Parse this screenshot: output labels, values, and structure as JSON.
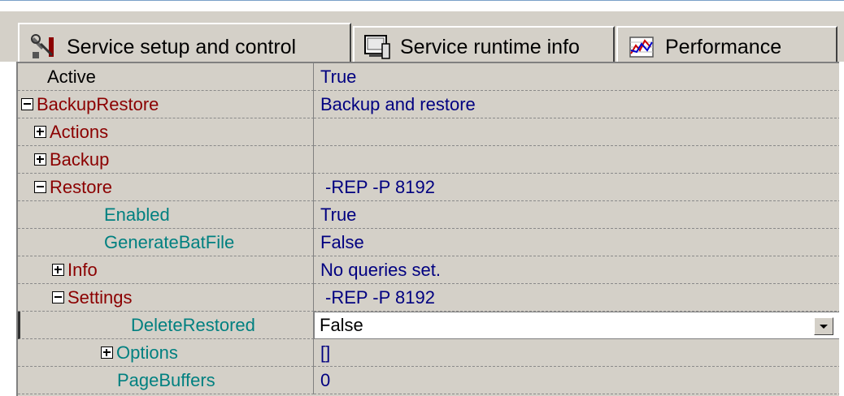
{
  "tabs": [
    {
      "label": "Service setup and control",
      "icon": "tools-icon"
    },
    {
      "label": "Service runtime info",
      "icon": "monitor-icon"
    },
    {
      "label": "Performance",
      "icon": "chart-icon"
    }
  ],
  "properties": [
    {
      "name": "Active",
      "value": "True"
    },
    {
      "name": "BackupRestore",
      "value": "Backup and restore"
    },
    {
      "name": "Actions",
      "value": ""
    },
    {
      "name": "Backup",
      "value": ""
    },
    {
      "name": "Restore",
      "value": "-REP -P 8192"
    },
    {
      "name": "Enabled",
      "value": "True"
    },
    {
      "name": "GenerateBatFile",
      "value": "False"
    },
    {
      "name": "Info",
      "value": "No queries set."
    },
    {
      "name": "Settings",
      "value": "-REP -P 8192"
    },
    {
      "name": "DeleteRestored",
      "value": "False"
    },
    {
      "name": "Options",
      "value": "[]"
    },
    {
      "name": "PageBuffers",
      "value": "0"
    }
  ]
}
